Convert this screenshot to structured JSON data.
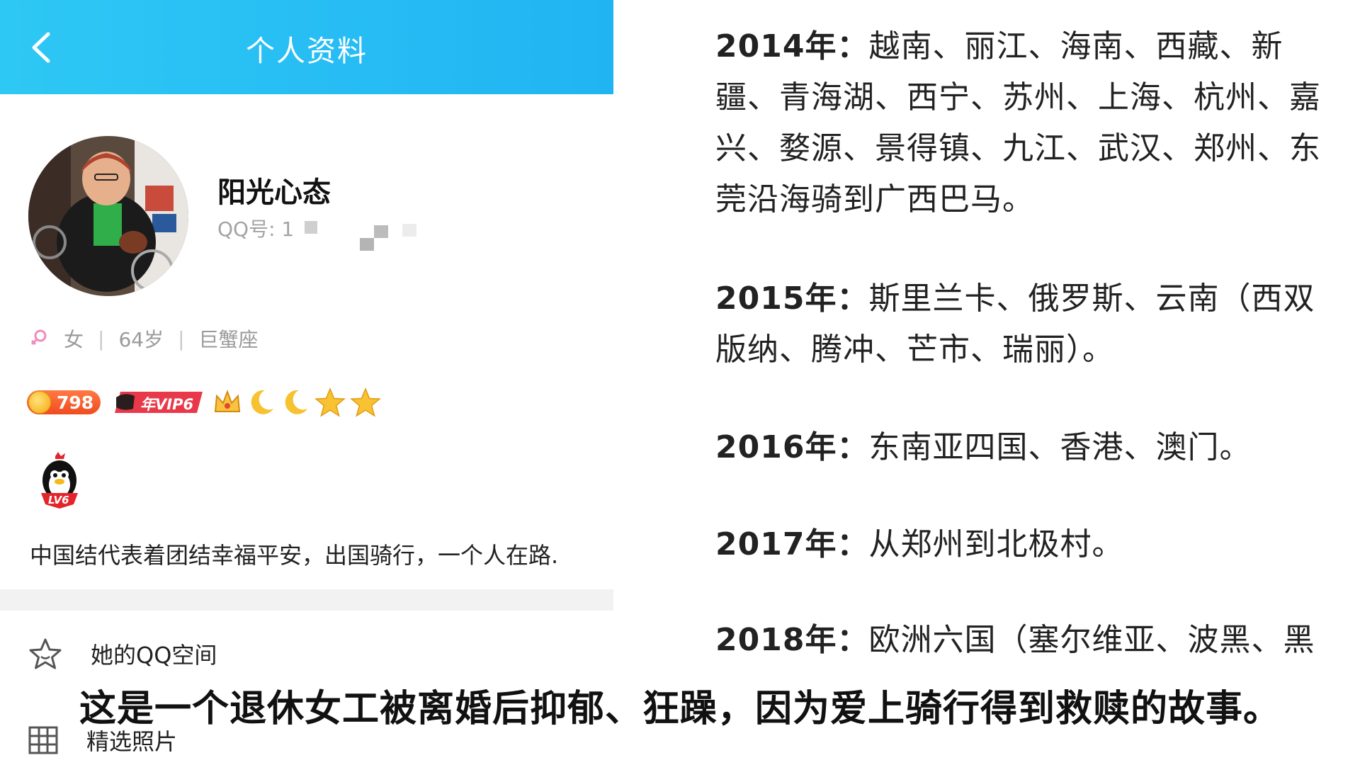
{
  "header": {
    "title": "个人资料",
    "back_icon": "chevron-left-icon"
  },
  "profile": {
    "nickname": "阳光心态",
    "qq_label": "QQ号: 1",
    "gender": "女",
    "age": "64岁",
    "zodiac": "巨蟹座",
    "coin_count": "798",
    "vip_label": "年VIP6",
    "level_badge": "LV6",
    "signature": "中国结代表着团结幸福平安，出国骑行，一个人在路."
  },
  "menu": [
    {
      "label": "她的QQ空间",
      "icon": "star-outline-icon"
    },
    {
      "label": "精选照片",
      "icon": "grid-icon"
    }
  ],
  "travel": [
    {
      "year": "2014年：",
      "text": "越南、丽江、海南、西藏、新疆、青海湖、西宁、苏州、上海、杭州、嘉兴、婺源、景得镇、九江、武汉、郑州、东莞沿海骑到广西巴马。"
    },
    {
      "year": "2015年：",
      "text": "斯里兰卡、俄罗斯、云南（西双版纳、腾冲、芒市、瑞丽）。"
    },
    {
      "year": "2016年：",
      "text": "东南亚四国、香港、澳门。"
    },
    {
      "year": "2017年：",
      "text": "从郑州到北极村。"
    },
    {
      "year": "2018年：",
      "text": "欧洲六国（塞尔维亚、波黑、黑"
    }
  ],
  "caption": "这是一个退休女工被离婚后抑郁、狂躁，因为爱上骑行得到救赎的故事。",
  "colors": {
    "header_bg": "#21b4f3",
    "divider": "#f2f2f2"
  }
}
